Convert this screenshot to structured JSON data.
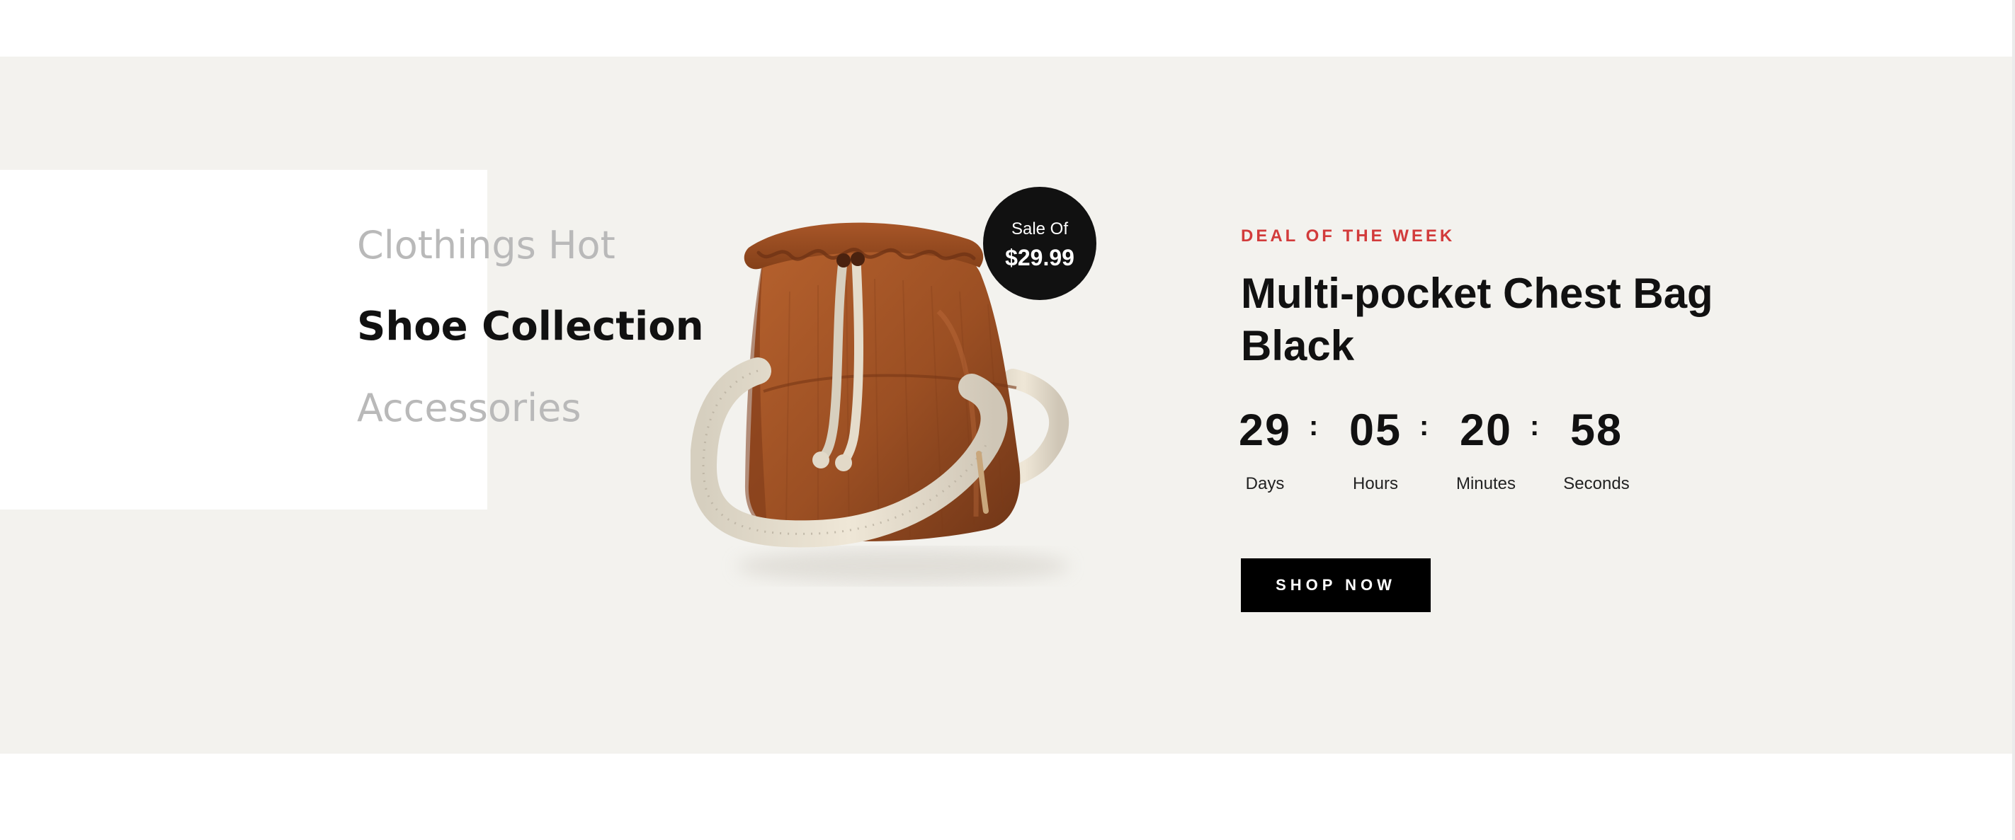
{
  "categories": [
    {
      "label": "Clothings Hot",
      "active": false
    },
    {
      "label": "Shoe Collection",
      "active": true
    },
    {
      "label": "Accessories",
      "active": false
    }
  ],
  "product": {
    "image_icon": "bucket-bag-image",
    "sale_label": "Sale Of",
    "sale_price": "$29.99"
  },
  "deal": {
    "kicker": "DEAL OF THE WEEK",
    "title": "Multi-pocket Chest Bag Black",
    "countdown": [
      {
        "value": "29",
        "label": "Days"
      },
      {
        "value": "05",
        "label": "Hours"
      },
      {
        "value": "20",
        "label": "Minutes"
      },
      {
        "value": "58",
        "label": "Seconds"
      }
    ],
    "separator": ":",
    "button_label": "SHOP NOW"
  },
  "colors": {
    "section_background": "#f3f2ee",
    "accent_red": "#d23b3b",
    "text_dark": "#111111",
    "muted_text": "#b9b9b9",
    "button_background": "#000000",
    "bag_brown": "#9b4f23",
    "strap_cream": "#e7dfcf"
  }
}
